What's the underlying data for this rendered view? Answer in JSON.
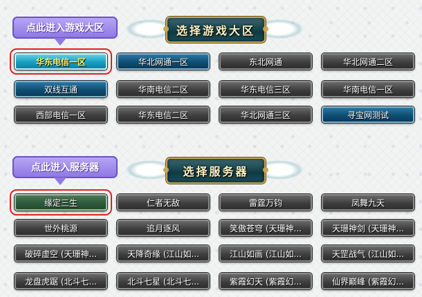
{
  "zones": {
    "title": "选择游戏大区",
    "hint": "点此进入游戏大区",
    "rows": [
      [
        {
          "label": "华东电信一区",
          "style": "teal",
          "selected": true
        },
        {
          "label": "华北网通一区",
          "style": "blue"
        },
        {
          "label": "东北网通",
          "style": "gray"
        },
        {
          "label": "华北网通二区",
          "style": "gray"
        }
      ],
      [
        {
          "label": "双线互通",
          "style": "blue"
        },
        {
          "label": "华南电信二区",
          "style": "gray"
        },
        {
          "label": "华东电信三区",
          "style": "gray"
        },
        {
          "label": "华南电信一区",
          "style": "gray"
        }
      ],
      [
        {
          "label": "西部电信一区",
          "style": "gray"
        },
        {
          "label": "华东电信二区",
          "style": "gray"
        },
        {
          "label": "华北网通三区",
          "style": "gray"
        },
        {
          "label": "寻宝网测试",
          "style": "blue"
        }
      ]
    ]
  },
  "servers": {
    "title": "选择服务器",
    "hint": "点此进入服务器",
    "rows": [
      [
        {
          "label": "缘定三生",
          "style": "green",
          "selected": true
        },
        {
          "label": "仁者无敌",
          "style": "gray"
        },
        {
          "label": "雷霆万钧",
          "style": "gray"
        },
        {
          "label": "凤舞九天",
          "style": "gray"
        }
      ],
      [
        {
          "label": "世外桃源",
          "style": "gray"
        },
        {
          "label": "追月逐风",
          "style": "gray"
        },
        {
          "label": "笑傲苍穹 (天珊神...",
          "style": "gray"
        },
        {
          "label": "天珊神剑 (天珊神...",
          "style": "gray"
        }
      ],
      [
        {
          "label": "破碎虚空 (天珊神...",
          "style": "gray"
        },
        {
          "label": "天降奇缘 (江山如...",
          "style": "gray"
        },
        {
          "label": "江山如画 (江山如...",
          "style": "gray"
        },
        {
          "label": "天罡战气 (江山如...",
          "style": "gray"
        }
      ],
      [
        {
          "label": "龙盘虎踞 (北斗七...",
          "style": "gray"
        },
        {
          "label": "北斗七星 (北斗七...",
          "style": "gray"
        },
        {
          "label": "紫霞幻天 (紫霞幻...",
          "style": "gray"
        },
        {
          "label": "仙界巅峰 (紫霞幻...",
          "style": "gray"
        }
      ]
    ]
  }
}
